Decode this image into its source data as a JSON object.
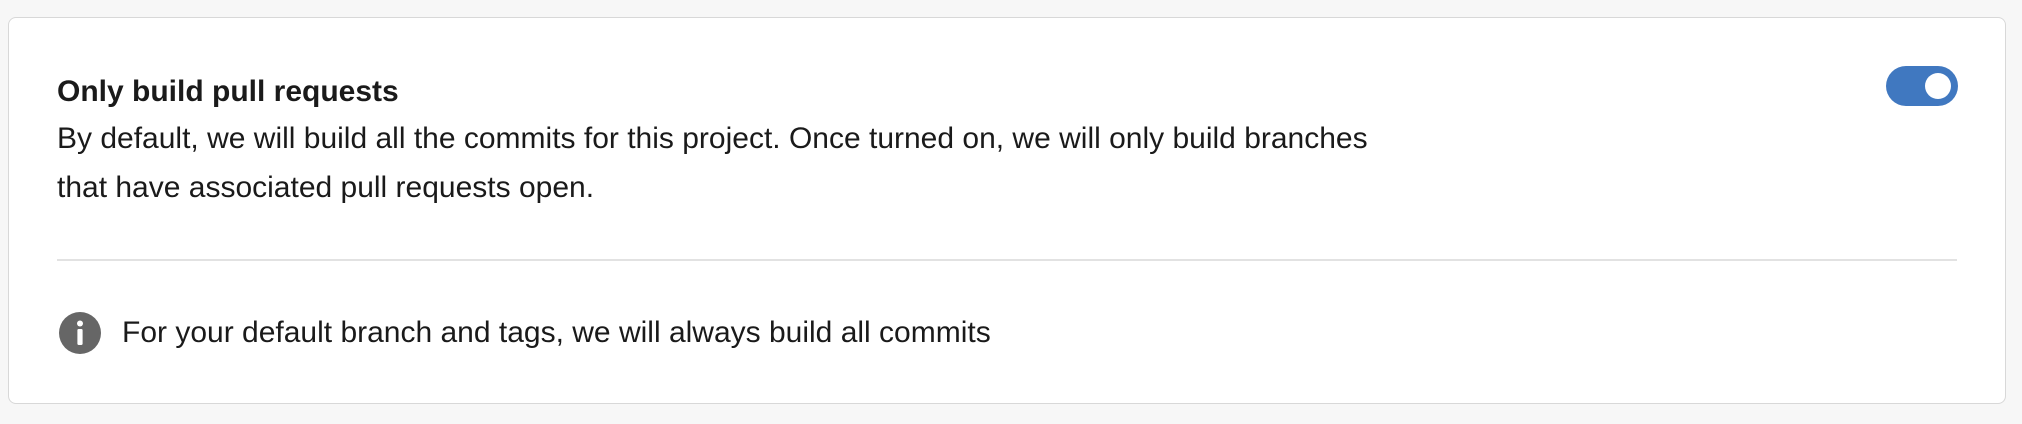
{
  "setting": {
    "title": "Only build pull requests",
    "description": "By default, we will build all the commits for this project. Once turned on, we will only build branches that have associated pull requests open.",
    "toggle_on": true
  },
  "info": {
    "icon": "info-icon",
    "text": "For your default branch and tags, we will always build all commits"
  },
  "colors": {
    "toggle_on": "#4078c0",
    "icon": "#666666"
  }
}
